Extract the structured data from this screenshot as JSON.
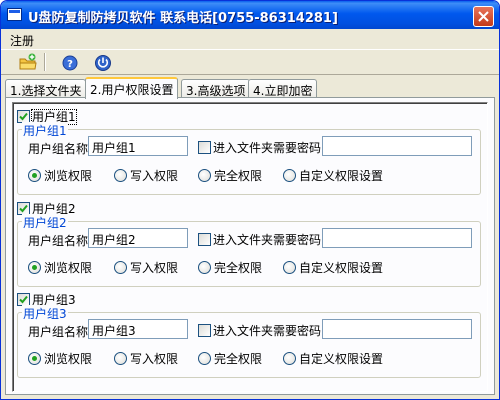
{
  "window": {
    "title": "U盘防复制防拷贝软件  联系电话[0755-86314281]"
  },
  "menu": {
    "register": "注册"
  },
  "toolbar": {
    "buttons": [
      "add-folder-icon",
      "help-icon",
      "power-icon"
    ]
  },
  "tabs": [
    {
      "label": "1.选择文件夹",
      "active": false
    },
    {
      "label": "2.用户权限设置",
      "active": true
    },
    {
      "label": "3.高级选项",
      "active": false
    },
    {
      "label": "4.立即加密",
      "active": false
    }
  ],
  "groups": [
    {
      "checkbox_label": "用户组1",
      "checked": true,
      "legend": "用户组1",
      "name_label": "用户组名称",
      "name_value": "用户组1",
      "password_label": "进入文件夹需要密码",
      "password_checked": false,
      "password_value": "",
      "radios": [
        "浏览权限",
        "写入权限",
        "完全权限",
        "自定义权限设置"
      ],
      "selected": 0
    },
    {
      "checkbox_label": "用户组2",
      "checked": true,
      "legend": "用户组2",
      "name_label": "用户组名称",
      "name_value": "用户组2",
      "password_label": "进入文件夹需要密码",
      "password_checked": false,
      "password_value": "",
      "radios": [
        "浏览权限",
        "写入权限",
        "完全权限",
        "自定义权限设置"
      ],
      "selected": 0
    },
    {
      "checkbox_label": "用户组3",
      "checked": true,
      "legend": "用户组3",
      "name_label": "用户组名称",
      "name_value": "用户组3",
      "password_label": "进入文件夹需要密码",
      "password_checked": false,
      "password_value": "",
      "radios": [
        "浏览权限",
        "写入权限",
        "完全权限",
        "自定义权限设置"
      ],
      "selected": 0
    }
  ],
  "colors": {
    "titlebar": "#0058ee",
    "legend": "#0046d5",
    "radio_dot": "#21a121",
    "tab_highlight": "#ffc83c"
  }
}
